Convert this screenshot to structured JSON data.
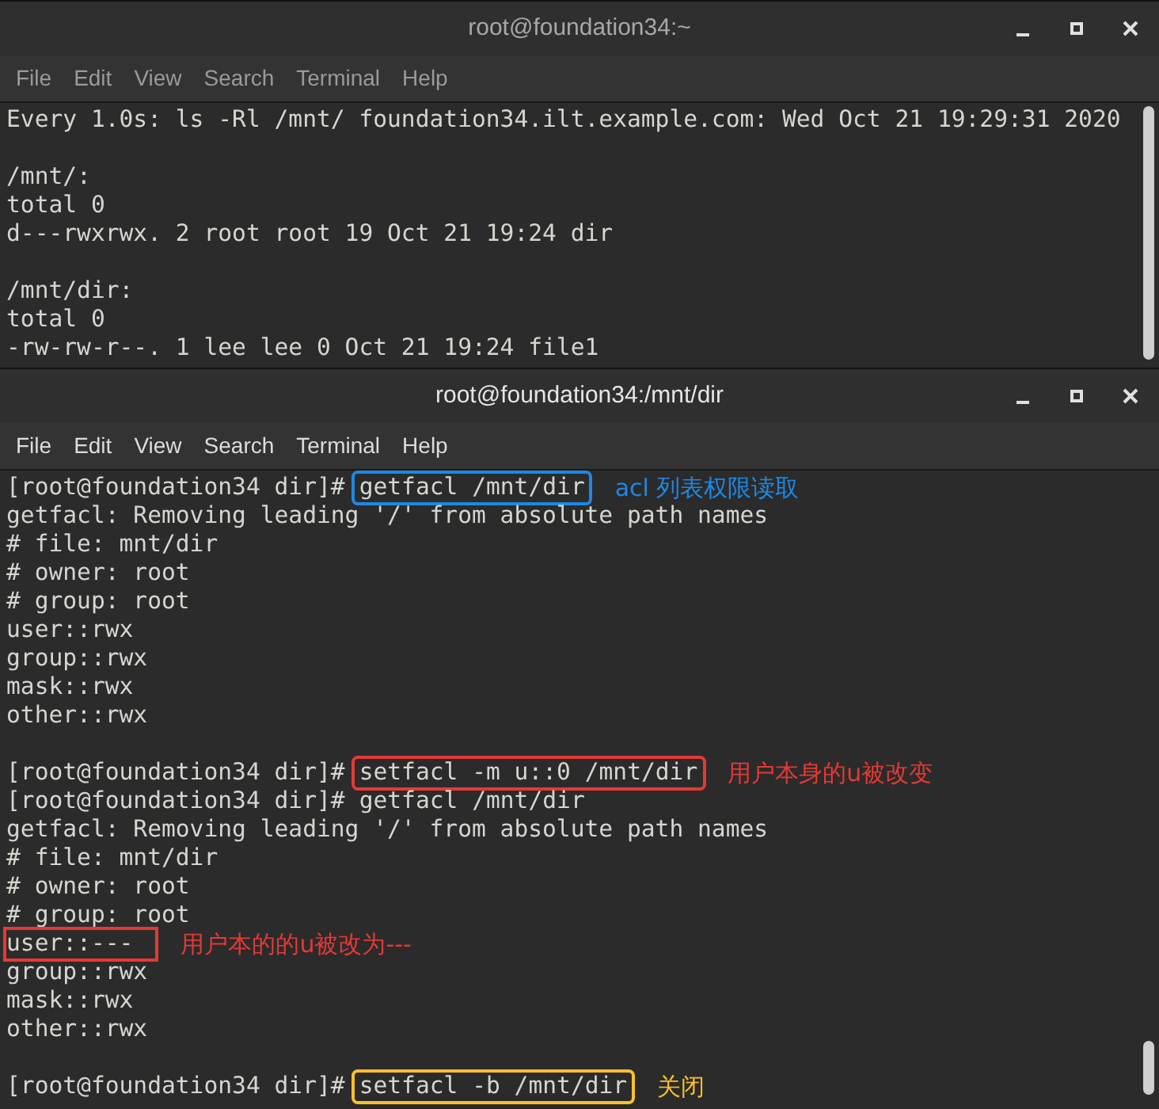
{
  "windows": [
    {
      "title": "root@foundation34:~",
      "active": false,
      "menu": [
        "File",
        "Edit",
        "View",
        "Search",
        "Terminal",
        "Help"
      ],
      "lines": [
        {
          "kind": "output",
          "text": "Every 1.0s: ls -Rl /mnt/ foundation34.ilt.example.com: Wed Oct 21 19:29:31 2020"
        },
        {
          "kind": "blank"
        },
        {
          "kind": "output",
          "text": "/mnt/:"
        },
        {
          "kind": "output",
          "text": "total 0"
        },
        {
          "kind": "output",
          "text": "d---rwxrwx. 2 root root 19 Oct 21 19:24 dir"
        },
        {
          "kind": "blank"
        },
        {
          "kind": "output",
          "text": "/mnt/dir:"
        },
        {
          "kind": "output",
          "text": "total 0"
        },
        {
          "kind": "output",
          "text": "-rw-rw-r--. 1 lee lee 0 Oct 21 19:24 file1"
        }
      ]
    },
    {
      "title": "root@foundation34:/mnt/dir",
      "active": true,
      "menu": [
        "File",
        "Edit",
        "View",
        "Search",
        "Terminal",
        "Help"
      ],
      "lines": [
        {
          "kind": "prompt",
          "prompt": "[root@foundation34 dir]#",
          "command": "getfacl /mnt/dir",
          "annotation": {
            "color": "#1e88e5",
            "note": "acl 列表权限读取"
          }
        },
        {
          "kind": "output",
          "text": "getfacl: Removing leading '/' from absolute path names"
        },
        {
          "kind": "output",
          "text": "# file: mnt/dir"
        },
        {
          "kind": "output",
          "text": "# owner: root"
        },
        {
          "kind": "output",
          "text": "# group: root"
        },
        {
          "kind": "output",
          "text": "user::rwx"
        },
        {
          "kind": "output",
          "text": "group::rwx"
        },
        {
          "kind": "output",
          "text": "mask::rwx"
        },
        {
          "kind": "output",
          "text": "other::rwx"
        },
        {
          "kind": "blank"
        },
        {
          "kind": "prompt",
          "prompt": "[root@foundation34 dir]#",
          "command": "setfacl -m u::0 /mnt/dir",
          "annotation": {
            "color": "#e53935",
            "note": "用户本身的u被改变"
          }
        },
        {
          "kind": "prompt",
          "prompt": "[root@foundation34 dir]#",
          "command": "getfacl /mnt/dir"
        },
        {
          "kind": "output",
          "text": "getfacl: Removing leading '/' from absolute path names"
        },
        {
          "kind": "output",
          "text": "# file: mnt/dir"
        },
        {
          "kind": "output",
          "text": "# owner: root"
        },
        {
          "kind": "output",
          "text": "# group: root"
        },
        {
          "kind": "output",
          "text": "user::---",
          "annotation": {
            "color": "#e53935",
            "note": "用户本的的u被改为---"
          }
        },
        {
          "kind": "output",
          "text": "group::rwx"
        },
        {
          "kind": "output",
          "text": "mask::rwx"
        },
        {
          "kind": "output",
          "text": "other::rwx"
        },
        {
          "kind": "blank"
        },
        {
          "kind": "prompt",
          "prompt": "[root@foundation34 dir]#",
          "command": "setfacl -b /mnt/dir",
          "annotation": {
            "color": "#fbc02d",
            "note": "关闭"
          }
        }
      ]
    }
  ]
}
